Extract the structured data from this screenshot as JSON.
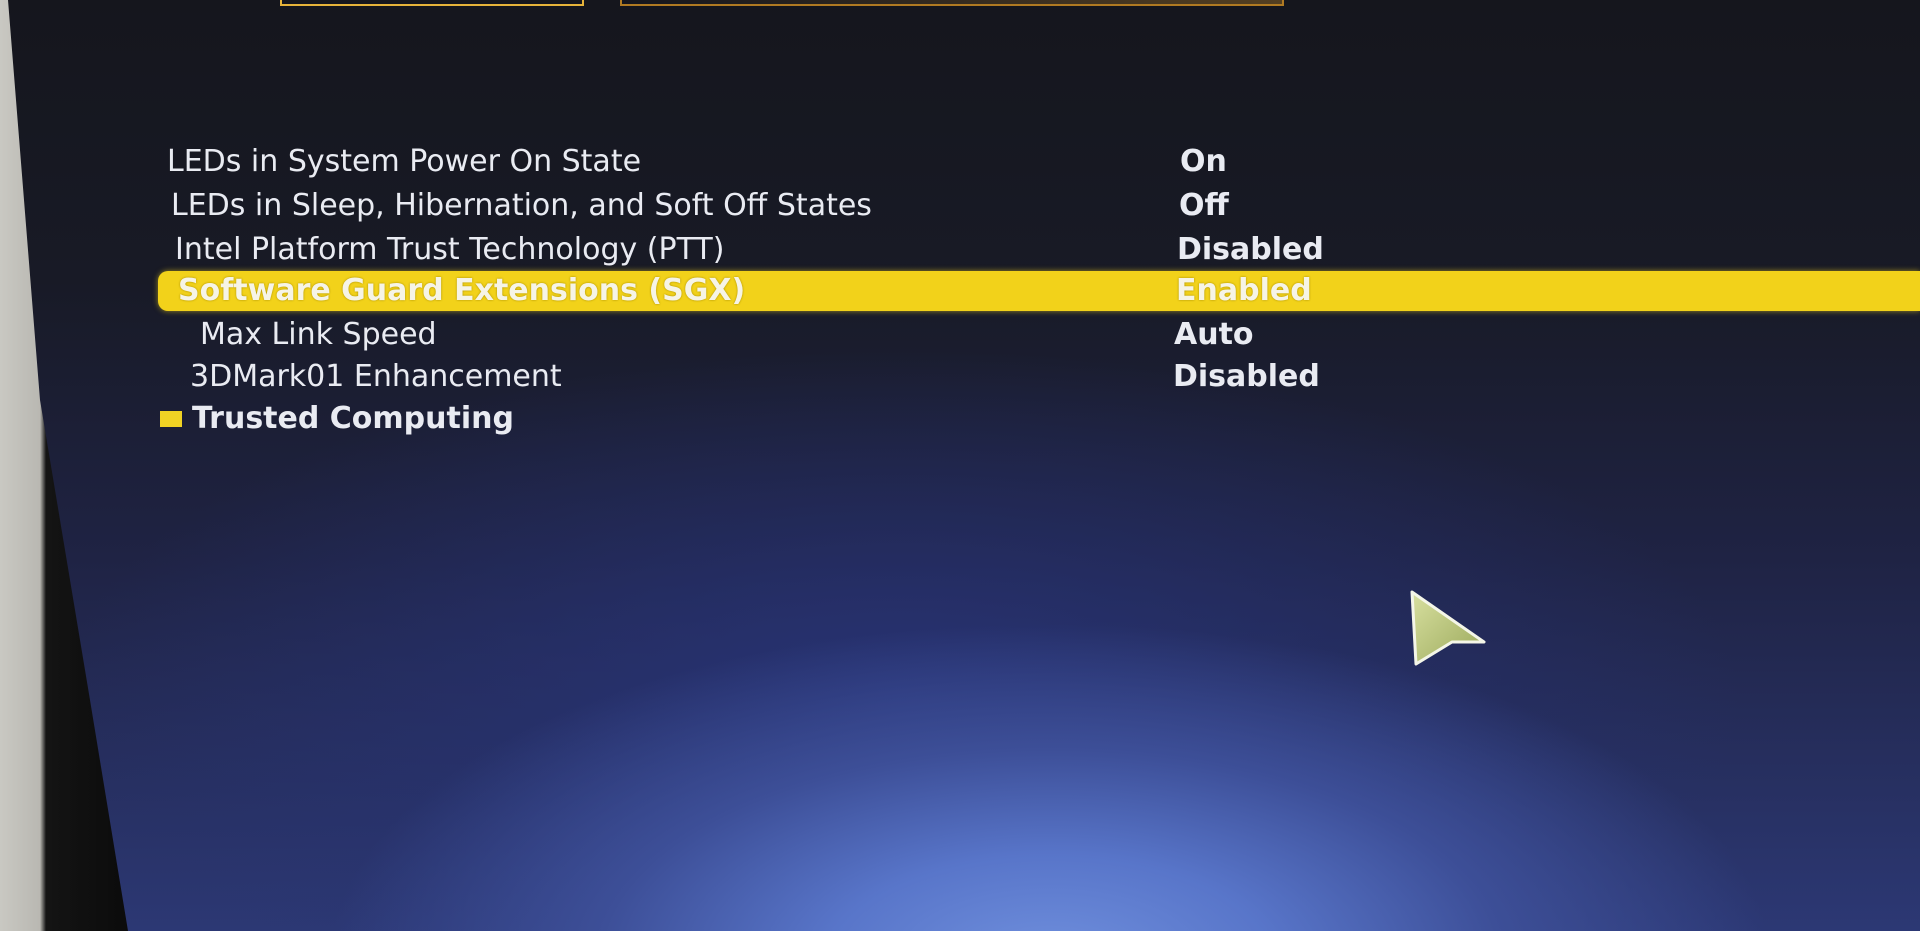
{
  "settings": [
    {
      "label": "LEDs in System Power On State",
      "value": "On"
    },
    {
      "label": "LEDs in Sleep, Hibernation, and Soft Off States",
      "value": "Off"
    },
    {
      "label": "Intel Platform Trust Technology (PTT)",
      "value": "Disabled"
    },
    {
      "label": "Software Guard Extensions (SGX)",
      "value": "Enabled"
    },
    {
      "label": "Max Link Speed",
      "value": "Auto"
    },
    {
      "label": "3DMark01 Enhancement",
      "value": "Disabled"
    }
  ],
  "submenu": {
    "label": "Trusted Computing"
  },
  "colors": {
    "highlight": "#f2d21a",
    "text": "#e9ebf2",
    "submenu_bullet": "#f0d224"
  },
  "icons": {
    "cursor": "cursor-arrow-icon",
    "submenu_bullet": "submenu-bullet-icon"
  }
}
